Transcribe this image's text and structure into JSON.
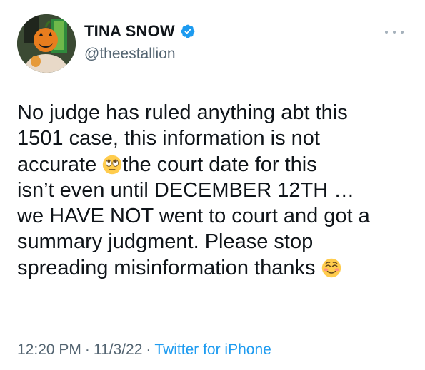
{
  "author": {
    "display_name": "TINA SNOW",
    "handle": "@theestallion",
    "verified": true,
    "avatar_icon": "pumpkin-mask-avatar"
  },
  "menu": {
    "icon": "more-dots-icon"
  },
  "tweet": {
    "lines": [
      {
        "before": "No judge has ruled anything abt this"
      },
      {
        "before": "1501 case, this information is not"
      },
      {
        "before": "accurate ",
        "emoji": "eye-roll-emoji",
        "after": "the court date for this"
      },
      {
        "before": "isn’t even until DECEMBER 12TH …"
      },
      {
        "before": "we HAVE NOT went to court and got a"
      },
      {
        "before": "summary judgment. Please stop"
      },
      {
        "before": "spreading misinformation thanks ",
        "emoji": "smiling-blush-emoji"
      }
    ]
  },
  "meta": {
    "time": "12:20 PM",
    "date": "11/3/22",
    "separator": "·",
    "source": "Twitter for iPhone"
  },
  "colors": {
    "text": "#0f1419",
    "secondary": "#536471",
    "link": "#1d9bf0",
    "verified": "#1d9bf0"
  }
}
